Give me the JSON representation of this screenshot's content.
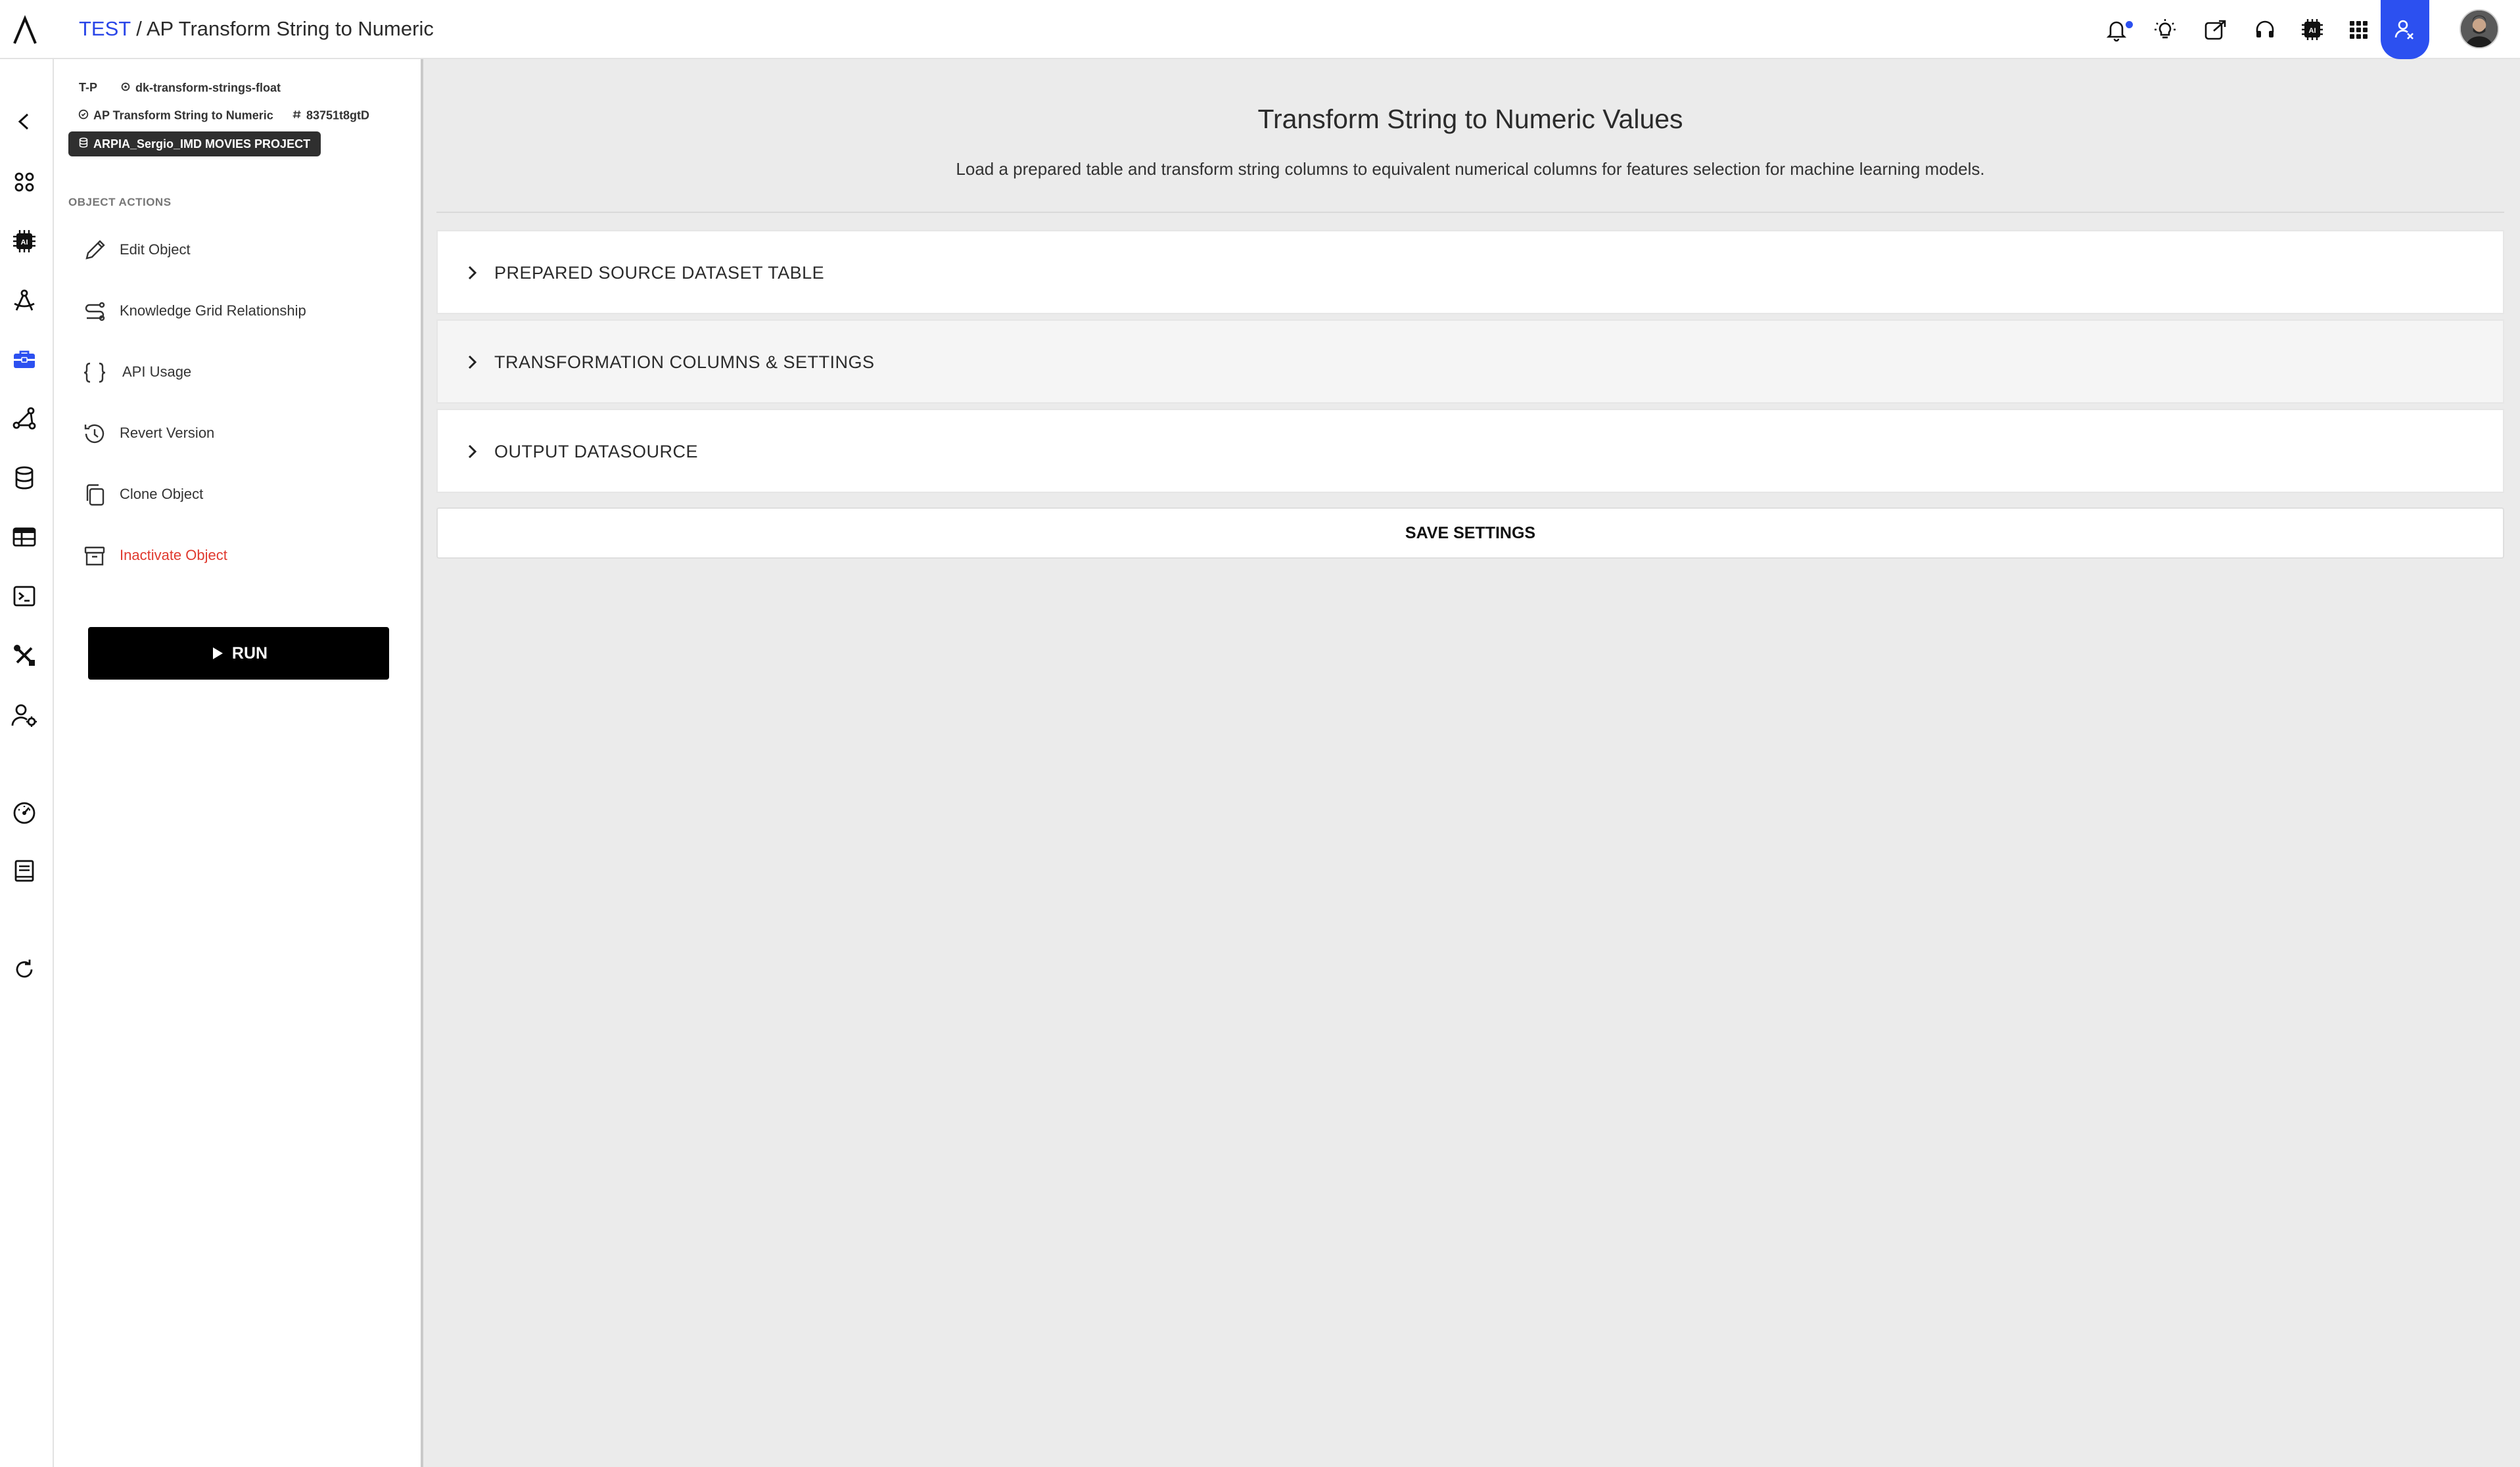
{
  "topbar": {
    "breadcrumb_root": "TEST",
    "breadcrumb_sep": " / ",
    "breadcrumb_current": "AP Transform String to Numeric",
    "icons": [
      "bell-icon",
      "lightbulb-icon",
      "share-icon",
      "support-headset-icon",
      "ai-chip-icon",
      "apps-grid-icon",
      "user-assist-icon",
      "avatar"
    ],
    "accent_color": "#2c50f0"
  },
  "rail": {
    "icons": [
      "back-arrow-icon",
      "dashboard-icon",
      "ai-chip-icon",
      "tools-compass-icon",
      "toolbox-icon",
      "graph-nodes-icon",
      "database-icon",
      "table-icon",
      "terminal-icon",
      "wrench-screwdriver-icon",
      "user-settings-icon",
      "gauge-icon",
      "book-icon",
      "refresh-icon"
    ]
  },
  "panel": {
    "type_tag": "T-P",
    "slug": "dk-transform-strings-float",
    "object_name": "AP Transform String to Numeric",
    "object_id": "83751t8gtD",
    "project": "ARPIA_Sergio_IMD MOVIES PROJECT",
    "section_label": "OBJECT ACTIONS",
    "actions": [
      {
        "label": "Edit Object",
        "icon": "pencil-icon"
      },
      {
        "label": "Knowledge Grid Relationship",
        "icon": "route-icon"
      },
      {
        "label": "API Usage",
        "icon": "braces-icon"
      },
      {
        "label": "Revert Version",
        "icon": "history-icon"
      },
      {
        "label": "Clone Object",
        "icon": "copy-icon"
      },
      {
        "label": "Inactivate Object",
        "icon": "archive-icon"
      }
    ],
    "run_label": "RUN",
    "danger_color": "#e0392e"
  },
  "main": {
    "title": "Transform String to Numeric Values",
    "description": "Load a prepared table and transform string columns to equivalent numerical columns for features selection for machine learning models.",
    "sections": [
      {
        "label": "PREPARED SOURCE DATASET TABLE"
      },
      {
        "label": "TRANSFORMATION COLUMNS & SETTINGS"
      },
      {
        "label": "OUTPUT DATASOURCE"
      }
    ],
    "save_label": "SAVE SETTINGS"
  }
}
